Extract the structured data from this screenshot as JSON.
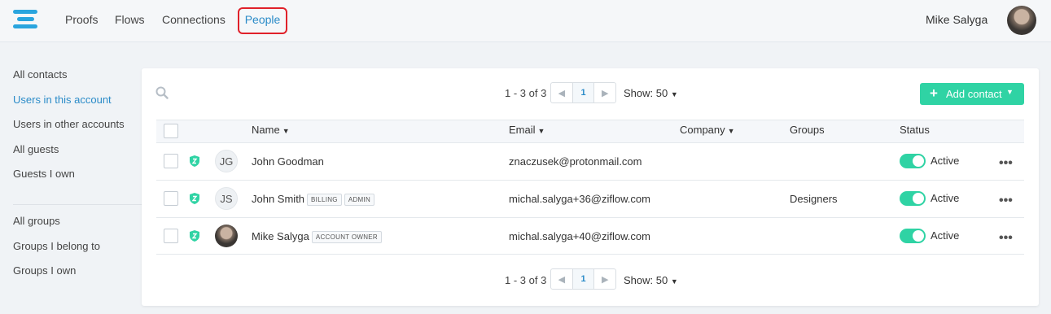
{
  "nav": {
    "items": [
      "Proofs",
      "Flows",
      "Connections"
    ],
    "active": "People",
    "user_name": "Mike Salyga"
  },
  "sidebar": {
    "contacts": [
      "All contacts",
      "Users in this account",
      "Users in other accounts",
      "All guests",
      "Guests I own"
    ],
    "groups": [
      "All groups",
      "Groups I belong to",
      "Groups I own"
    ],
    "active": "Users in this account"
  },
  "pagination": {
    "range": "1 - 3 of 3",
    "current_page": "1",
    "show": "Show: 50"
  },
  "add_contact_label": "Add contact",
  "table": {
    "headers": {
      "name": "Name",
      "email": "Email",
      "company": "Company",
      "groups": "Groups",
      "status": "Status"
    },
    "rows": [
      {
        "initials": "JG",
        "name": "John Goodman",
        "tags": [],
        "email": "znaczusek@protonmail.com",
        "company": "",
        "groups": "",
        "status": "Active",
        "active": true
      },
      {
        "initials": "JS",
        "name": "John Smith",
        "tags": [
          "BILLING",
          "ADMIN"
        ],
        "email": "michal.salyga+36@ziflow.com",
        "company": "",
        "groups": "Designers",
        "status": "Active",
        "active": true
      },
      {
        "initials": "",
        "name": "Mike Salyga",
        "tags": [
          "ACCOUNT OWNER"
        ],
        "email": "michal.salyga+40@ziflow.com",
        "company": "",
        "groups": "",
        "status": "Active",
        "active": true
      }
    ]
  },
  "colors": {
    "accent": "#2a8bc8",
    "add_button": "#2fd3a4",
    "toggle_on": "#2fd3a4",
    "highlight": "#e0212a",
    "shield": "#2fd3a4"
  }
}
